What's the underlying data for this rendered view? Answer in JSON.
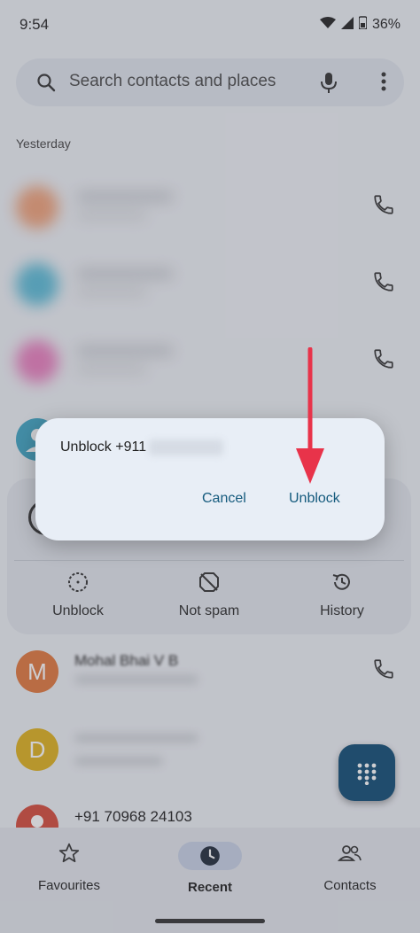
{
  "status_bar": {
    "time": "9:54",
    "battery": "36%"
  },
  "search": {
    "placeholder": "Search contacts and places"
  },
  "section": {
    "yesterday": "Yesterday"
  },
  "contacts": {
    "m_letter": "M",
    "m_name": "Mohal Bhai V B",
    "d_letter": "D",
    "last_number": "+91 70968 24103"
  },
  "panel": {
    "unblock_label": "Unblock",
    "not_spam_label": "Not spam",
    "history_label": "History"
  },
  "dialog": {
    "message": "Unblock +911",
    "cancel_label": "Cancel",
    "confirm_label": "Unblock"
  },
  "nav": {
    "favourites_label": "Favourites",
    "recent_label": "Recent",
    "contacts_label": "Contacts"
  },
  "colors": {
    "accent": "#145a7d",
    "fab": "#0f4c75",
    "arrow": "#e8334a",
    "avatar_m": "#e2783c",
    "avatar_d": "#e0b21c",
    "avatar_red": "#d64a3a"
  }
}
